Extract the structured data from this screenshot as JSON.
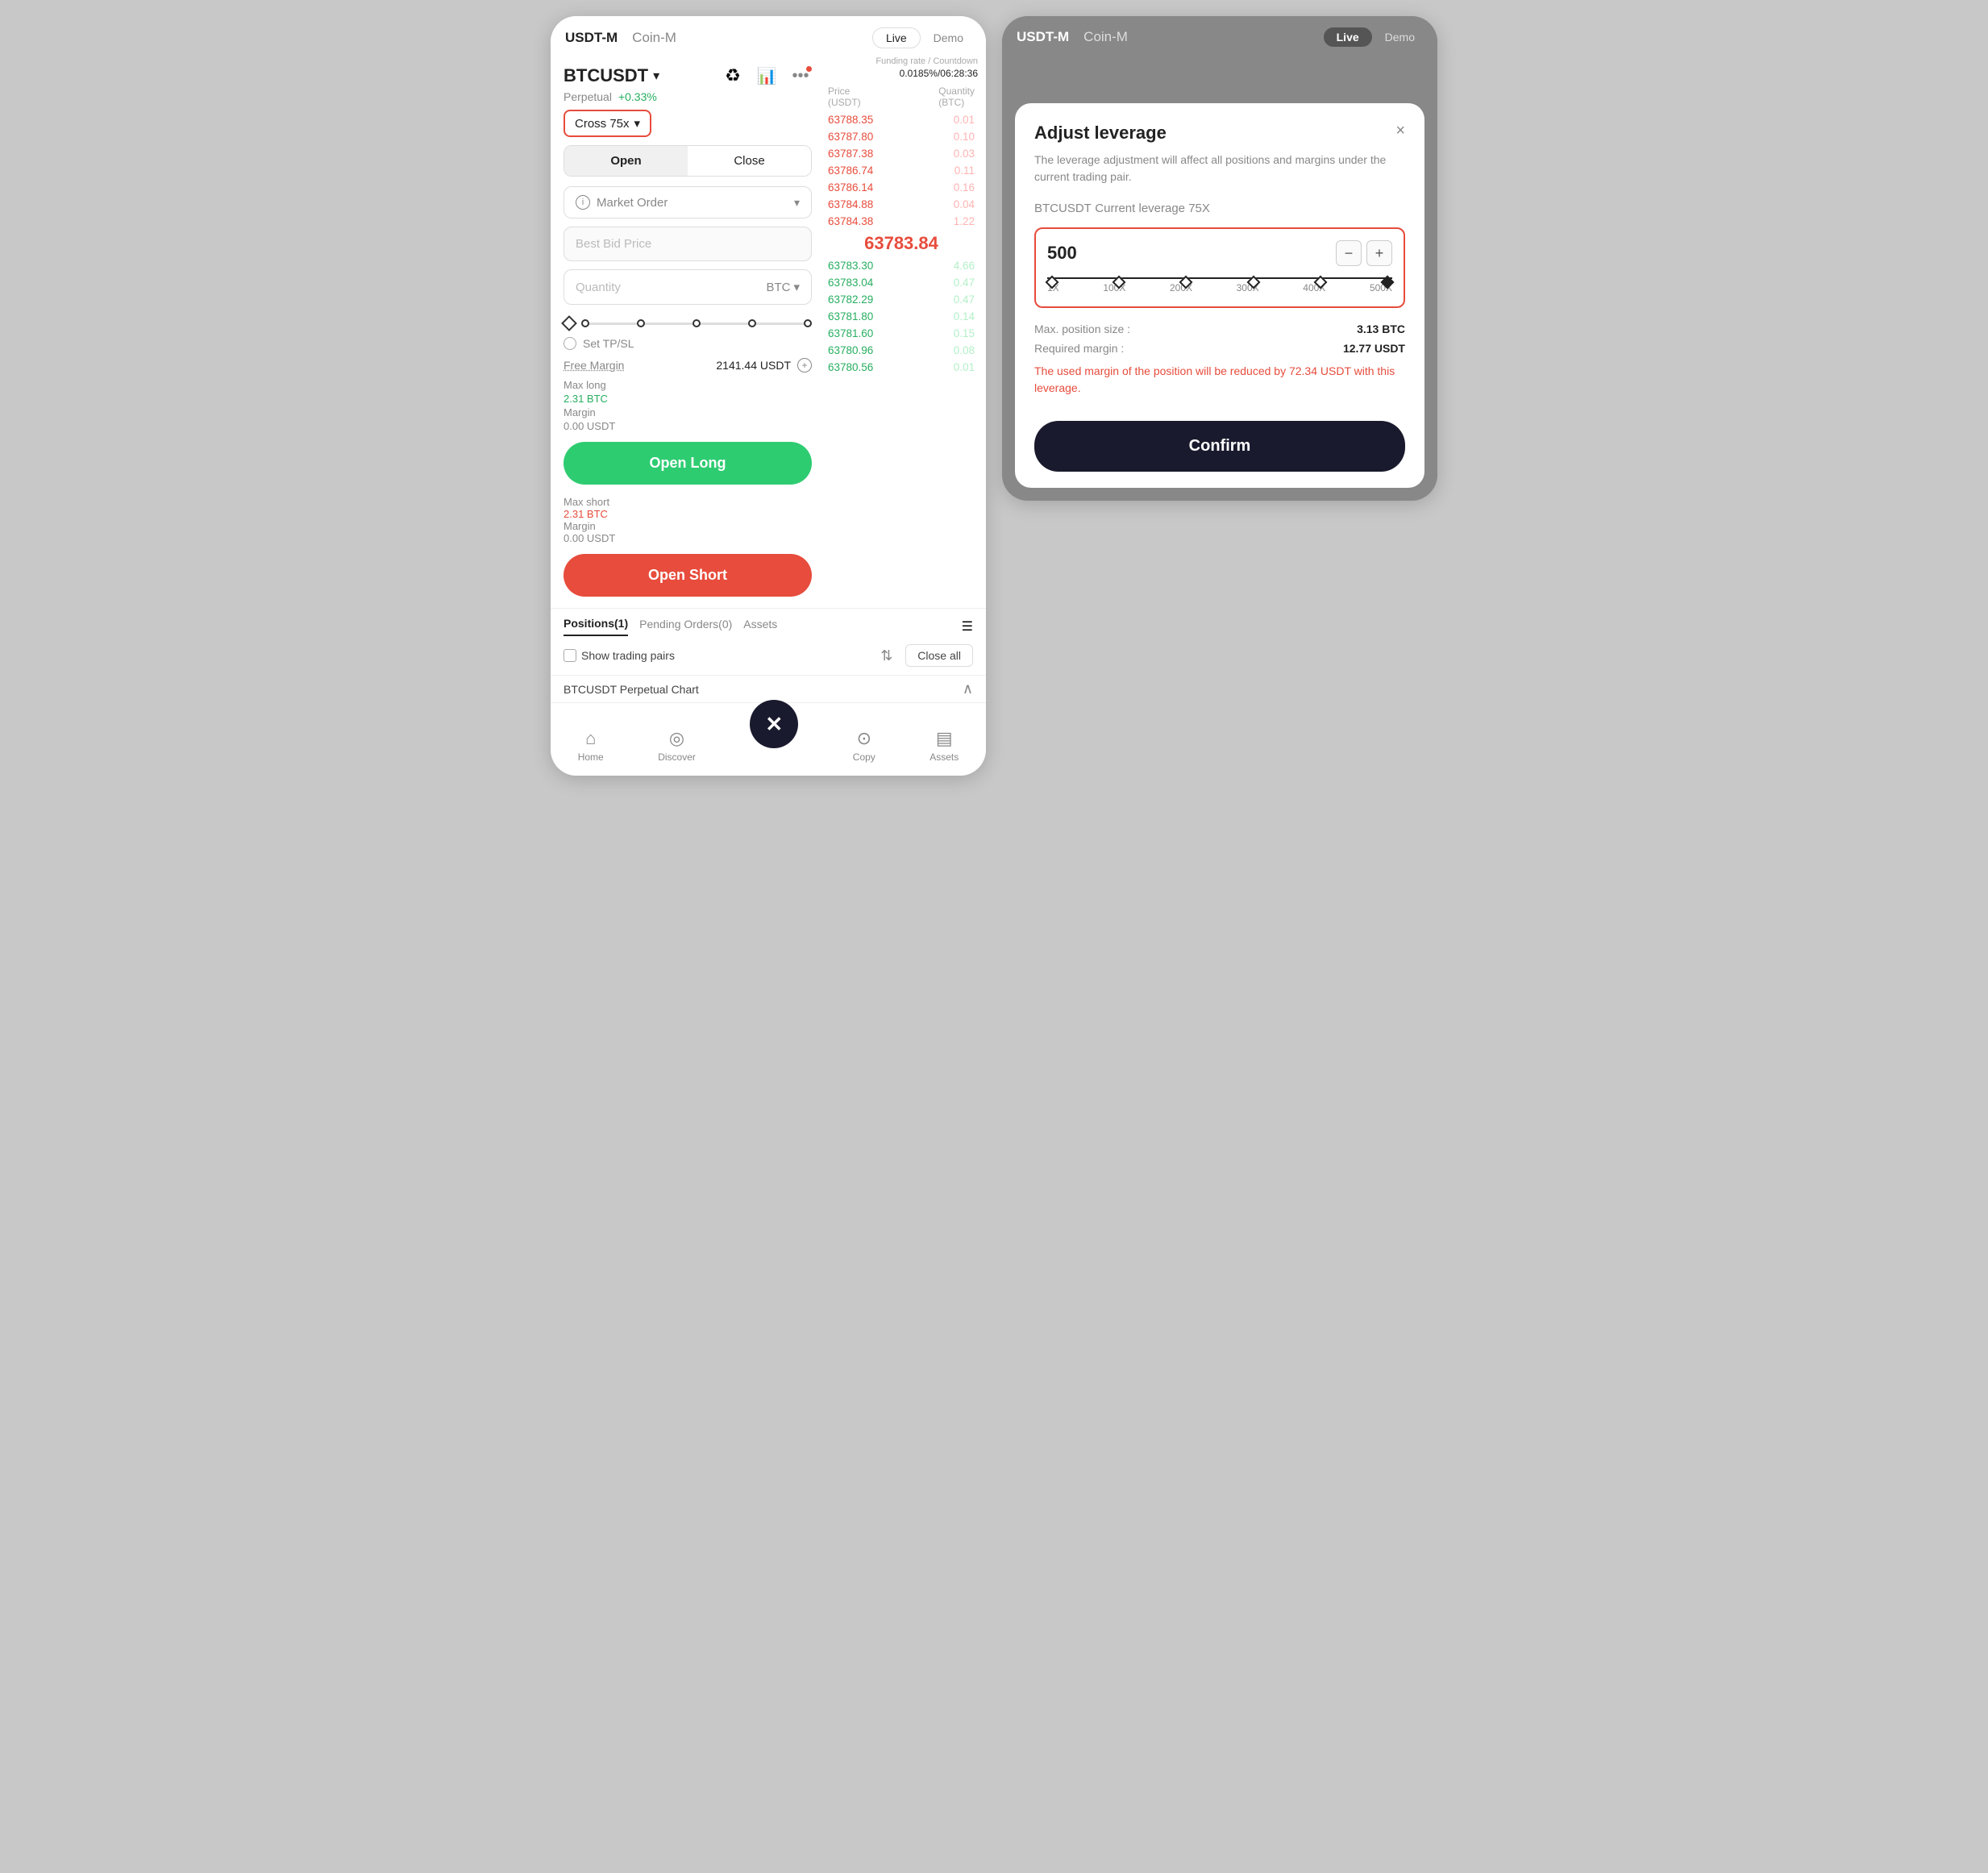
{
  "left_phone": {
    "header": {
      "tab_usdt": "USDT-M",
      "tab_coin": "Coin-M",
      "live_label": "Live",
      "demo_label": "Demo"
    },
    "pair": {
      "name": "BTCUSDT",
      "arrow": "▾",
      "perpetual": "Perpetual",
      "change": "+0.33%"
    },
    "leverage": {
      "label": "Cross 75x"
    },
    "open_close": {
      "open": "Open",
      "close": "Close"
    },
    "order_type": {
      "label": "Market Order"
    },
    "price_placeholder": "Best Bid Price",
    "qty_placeholder": "Quantity",
    "qty_unit": "BTC",
    "tpsl_label": "Set TP/SL",
    "free_margin": {
      "label": "Free Margin",
      "value": "2141.44 USDT"
    },
    "mid_price": "63783.84",
    "max_long": {
      "label": "Max long",
      "value": "2.31 BTC",
      "margin_label": "Margin",
      "margin_value": "0.00 USDT"
    },
    "open_long_btn": "Open Long",
    "max_short": {
      "label": "Max short",
      "value": "2.31 BTC",
      "margin_label": "Margin",
      "margin_value": "0.00 USDT"
    },
    "open_short_btn": "Open Short",
    "order_book": {
      "col1": "Price (USDT)",
      "col2": "Quantity (BTC)",
      "funding_label": "Funding rate / Countdown",
      "funding_rate": "0.0185%/06:28:36",
      "sells": [
        {
          "price": "63788.35",
          "qty": "0.01"
        },
        {
          "price": "63787.80",
          "qty": "0.10"
        },
        {
          "price": "63787.38",
          "qty": "0.03"
        },
        {
          "price": "63786.74",
          "qty": "0.11"
        },
        {
          "price": "63786.14",
          "qty": "0.16"
        },
        {
          "price": "63784.88",
          "qty": "0.04"
        },
        {
          "price": "63784.38",
          "qty": "1.22"
        }
      ],
      "buys": [
        {
          "price": "63783.30",
          "qty": "4.66"
        },
        {
          "price": "63783.04",
          "qty": "0.47"
        },
        {
          "price": "63782.29",
          "qty": "0.47"
        },
        {
          "price": "63781.80",
          "qty": "0.14"
        },
        {
          "price": "63781.60",
          "qty": "0.15"
        },
        {
          "price": "63780.96",
          "qty": "0.08"
        },
        {
          "price": "63780.56",
          "qty": "0.01"
        }
      ]
    },
    "tabs": {
      "positions": "Positions(1)",
      "pending": "Pending Orders(0)",
      "assets": "Assets"
    },
    "show_pairs_label": "Show trading pairs",
    "close_all_label": "Close all",
    "chart_label": "BTCUSDT Perpetual Chart",
    "nav": {
      "home": "Home",
      "discover": "Discover",
      "copy": "Copy",
      "assets": "Assets"
    }
  },
  "right_phone": {
    "header": {
      "tab_usdt": "USDT-M",
      "tab_coin": "Coin-M",
      "live_label": "Live",
      "demo_label": "Demo"
    },
    "dialog": {
      "title": "Adjust leverage",
      "close": "×",
      "description": "The leverage adjustment will affect all positions and margins under the current trading pair.",
      "pair_label": "BTCUSDT",
      "current_leverage": "Current leverage 75X",
      "leverage_value": "500",
      "slider_labels": [
        "1X",
        "100X",
        "200X",
        "300X",
        "400X",
        "500X"
      ],
      "max_position_label": "Max. position size :",
      "max_position_value": "3.13 BTC",
      "required_margin_label": "Required margin :",
      "required_margin_value": "12.77 USDT",
      "warning": "The used margin of the position will be reduced by 72.34 USDT with this leverage.",
      "confirm_label": "Confirm"
    }
  }
}
